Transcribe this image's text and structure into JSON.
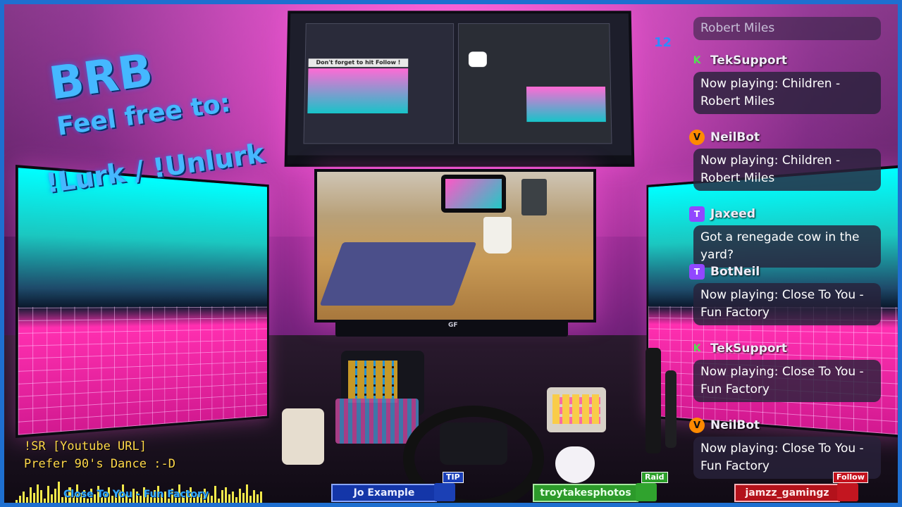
{
  "overlay": {
    "title": "BRB",
    "subtitle": "Feel free to:",
    "commands": "!Lurk / !Unlurk",
    "song_request_line1": "!SR [Youtube URL]",
    "song_request_line2": "Prefer 90's Dance   :-D",
    "now_playing_bar": "Close To You - Fun Factory",
    "viewer_count": "12"
  },
  "top_monitor": {
    "banner_text": "Don't forget to hit Follow !"
  },
  "center_monitor": {
    "brand": "GF"
  },
  "chat": {
    "messages": [
      {
        "user": "",
        "badge": "",
        "text": "Robert Miles"
      },
      {
        "user": "TekSupport",
        "badge": "K",
        "text": "Now playing: Children - Robert Miles"
      },
      {
        "user": "NeilBot",
        "badge": "V",
        "text": "Now playing: Children - Robert Miles"
      },
      {
        "user": "Jaxeed",
        "badge": "T",
        "text": "Got a renegade cow in the yard?"
      },
      {
        "user": "BotNeil",
        "badge": "T",
        "text": "Now playing: Close To You - Fun Factory"
      },
      {
        "user": "TekSupport",
        "badge": "K",
        "text": "Now playing: Close To You - Fun Factory"
      },
      {
        "user": "NeilBot",
        "badge": "V",
        "text": "Now playing: Close To You - Fun Factory"
      }
    ]
  },
  "alerts": {
    "tip": {
      "tag": "TIP",
      "name": "Jo Example"
    },
    "raid": {
      "tag": "Raid",
      "name": "troytakesphotos"
    },
    "follow": {
      "tag": "Follow",
      "name": "jamzz_gamingz"
    }
  },
  "colors": {
    "frame": "#1e6fd0",
    "overlay_text": "#45b8ff",
    "sr_text": "#ffd84a",
    "tip": "#1436a8",
    "raid": "#2c9a2a",
    "follow": "#b3121b"
  },
  "icons": {
    "kick": "kick-icon",
    "twitch": "twitch-icon",
    "bot": "bot-icon"
  }
}
